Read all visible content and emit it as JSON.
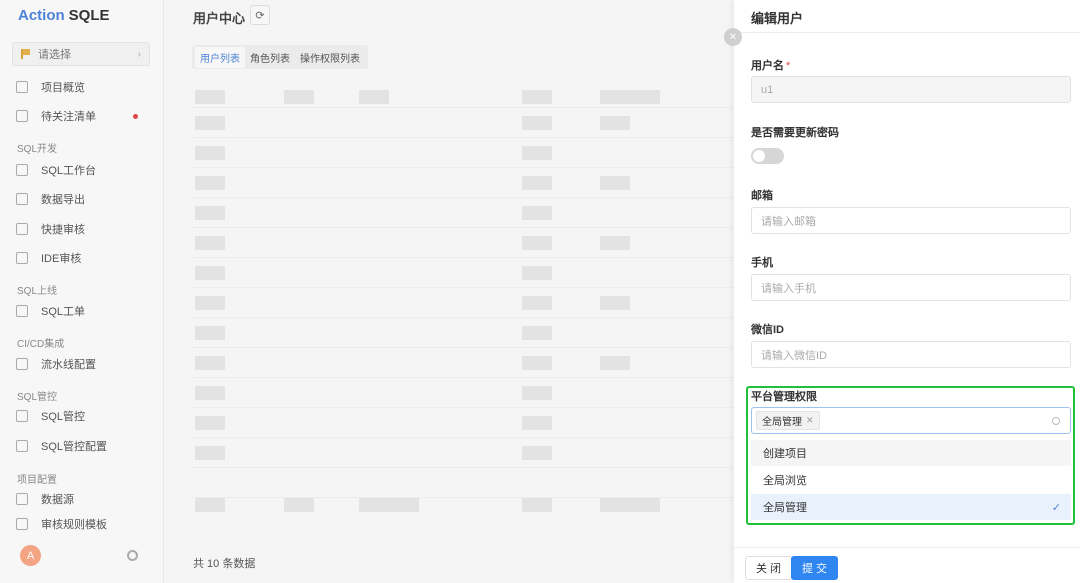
{
  "sidebar": {
    "logo_action": "Action",
    "logo_sqle": "SQLE",
    "project_placeholder": "请选择",
    "items": [
      {
        "label": "项目概览"
      },
      {
        "label": "待关注清单"
      },
      {
        "group": "SQL开发"
      },
      {
        "label": "SQL工作台"
      },
      {
        "label": "数据导出"
      },
      {
        "label": "快捷审核"
      },
      {
        "label": "IDE审核"
      },
      {
        "group": "SQL上线"
      },
      {
        "label": "SQL工单"
      },
      {
        "group": "CI/CD集成"
      },
      {
        "label": "流水线配置"
      },
      {
        "group": "SQL管控"
      },
      {
        "label": "SQL管控"
      },
      {
        "label": "SQL管控配置"
      },
      {
        "group": "项目配置"
      },
      {
        "label": "数据源"
      },
      {
        "label": "审核规则模板"
      }
    ],
    "avatar_letter": "A"
  },
  "main": {
    "title": "用户中心",
    "tabs": [
      {
        "label": "用户列表",
        "active": true
      },
      {
        "label": "角色列表",
        "active": false
      },
      {
        "label": "操作权限列表",
        "active": false
      }
    ],
    "footer": "共 10 条数据"
  },
  "drawer": {
    "title": "编辑用户",
    "username_label": "用户名",
    "username_value": "u1",
    "update_password_label": "是否需要更新密码",
    "update_password_on": false,
    "email_label": "邮箱",
    "email_placeholder": "请输入邮箱",
    "phone_label": "手机",
    "phone_placeholder": "请输入手机",
    "wechat_label": "微信ID",
    "wechat_placeholder": "请输入微信ID",
    "platform_permission_label": "平台管理权限",
    "selected_tags": [
      "全局管理"
    ],
    "options": [
      {
        "label": "创建项目",
        "selected": false
      },
      {
        "label": "全局浏览",
        "selected": false
      },
      {
        "label": "全局管理",
        "selected": true
      }
    ],
    "close_button": "关 闭",
    "submit_button": "提 交"
  },
  "colors": {
    "accent": "#2f86f0",
    "highlight": "#1ec238",
    "required": "#e04848"
  }
}
